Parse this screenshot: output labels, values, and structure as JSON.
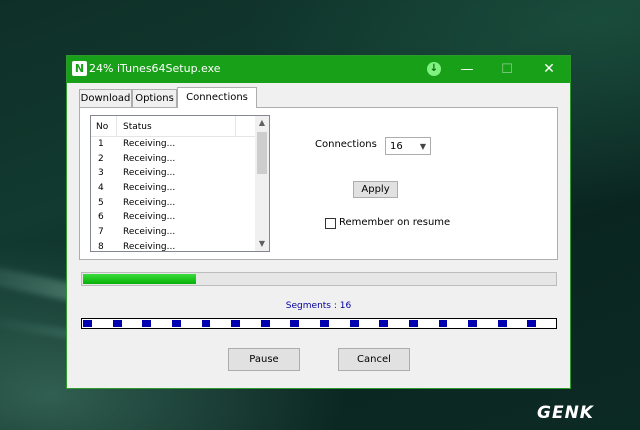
{
  "window": {
    "logo_letter": "N",
    "title_percent": "24%",
    "title_file": "iTunes64Setup.exe",
    "minimize": "—",
    "maximize": "☐",
    "close": "✕",
    "accent_color": "#19a019"
  },
  "tabs": [
    "Download",
    "Options",
    "Connections"
  ],
  "connections_list": {
    "headers": {
      "no": "No",
      "status": "Status"
    },
    "rows": [
      {
        "no": "1",
        "status": "Receiving..."
      },
      {
        "no": "2",
        "status": "Receiving..."
      },
      {
        "no": "3",
        "status": "Receiving..."
      },
      {
        "no": "4",
        "status": "Receiving..."
      },
      {
        "no": "5",
        "status": "Receiving..."
      },
      {
        "no": "6",
        "status": "Receiving..."
      },
      {
        "no": "7",
        "status": "Receiving..."
      },
      {
        "no": "8",
        "status": "Receiving..."
      }
    ]
  },
  "settings": {
    "connections_label": "Connections",
    "connections_value": "16",
    "apply_label": "Apply",
    "remember_label": "Remember on resume",
    "remember_checked": false
  },
  "progress": {
    "fraction": 0.24
  },
  "segments": {
    "label": "Segments : 16",
    "count": 16
  },
  "buttons": {
    "pause": "Pause",
    "cancel": "Cancel"
  },
  "watermark": "GENK"
}
